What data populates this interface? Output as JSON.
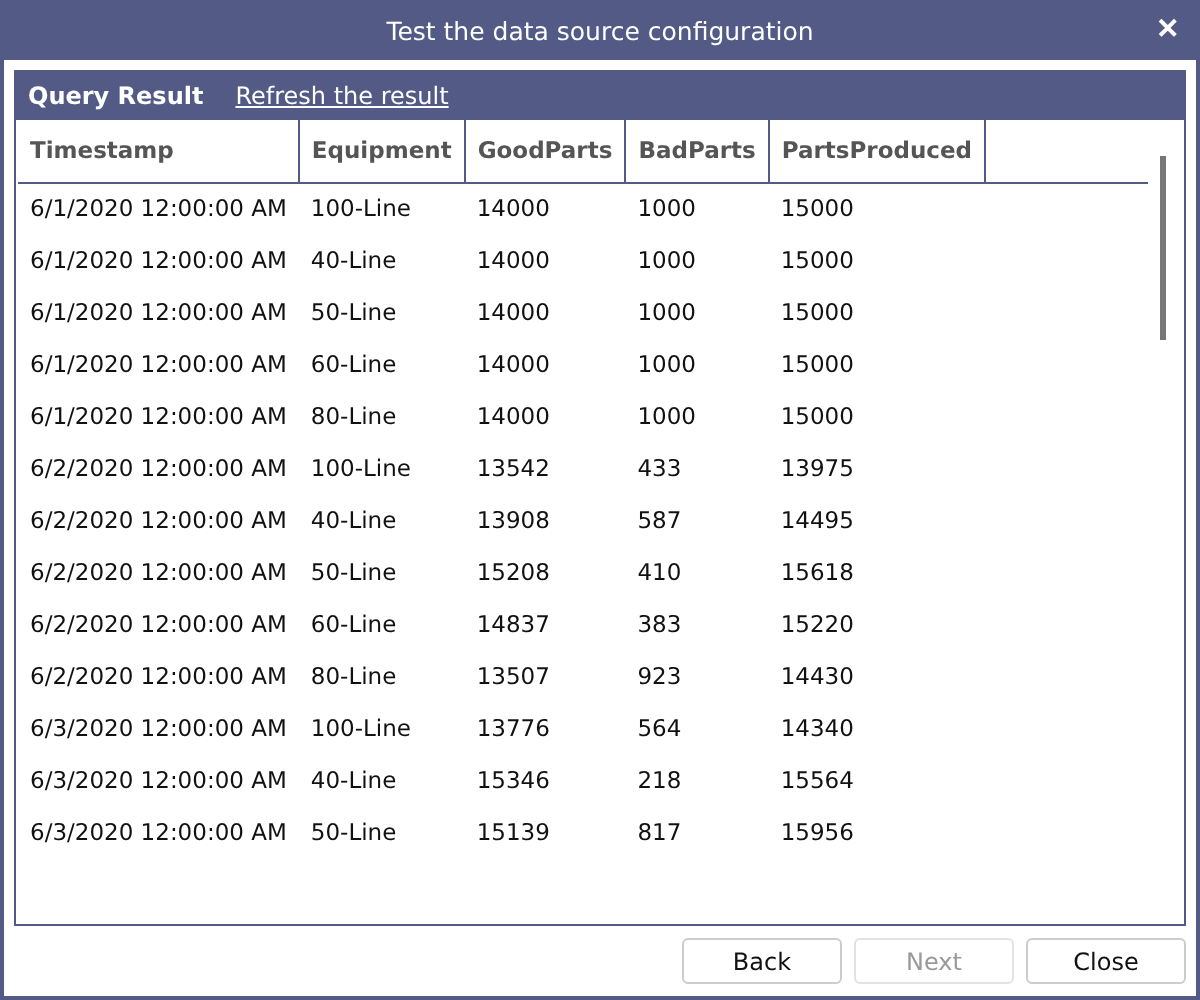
{
  "window": {
    "title": "Test the data source configuration",
    "close_glyph": "✕"
  },
  "panel": {
    "title": "Query Result",
    "link": "Refresh the result"
  },
  "table": {
    "columns": [
      "Timestamp",
      "Equipment",
      "GoodParts",
      "BadParts",
      "PartsProduced"
    ],
    "rows": [
      [
        "6/1/2020 12:00:00 AM",
        "100-Line",
        "14000",
        "1000",
        "15000"
      ],
      [
        "6/1/2020 12:00:00 AM",
        "40-Line",
        "14000",
        "1000",
        "15000"
      ],
      [
        "6/1/2020 12:00:00 AM",
        "50-Line",
        "14000",
        "1000",
        "15000"
      ],
      [
        "6/1/2020 12:00:00 AM",
        "60-Line",
        "14000",
        "1000",
        "15000"
      ],
      [
        "6/1/2020 12:00:00 AM",
        "80-Line",
        "14000",
        "1000",
        "15000"
      ],
      [
        "6/2/2020 12:00:00 AM",
        "100-Line",
        "13542",
        "433",
        "13975"
      ],
      [
        "6/2/2020 12:00:00 AM",
        "40-Line",
        "13908",
        "587",
        "14495"
      ],
      [
        "6/2/2020 12:00:00 AM",
        "50-Line",
        "15208",
        "410",
        "15618"
      ],
      [
        "6/2/2020 12:00:00 AM",
        "60-Line",
        "14837",
        "383",
        "15220"
      ],
      [
        "6/2/2020 12:00:00 AM",
        "80-Line",
        "13507",
        "923",
        "14430"
      ],
      [
        "6/3/2020 12:00:00 AM",
        "100-Line",
        "13776",
        "564",
        "14340"
      ],
      [
        "6/3/2020 12:00:00 AM",
        "40-Line",
        "15346",
        "218",
        "15564"
      ],
      [
        "6/3/2020 12:00:00 AM",
        "50-Line",
        "15139",
        "817",
        "15956"
      ]
    ]
  },
  "buttons": [
    {
      "label": "Back",
      "disabled": false
    },
    {
      "label": "Next",
      "disabled": true
    },
    {
      "label": "Close",
      "disabled": false
    }
  ]
}
